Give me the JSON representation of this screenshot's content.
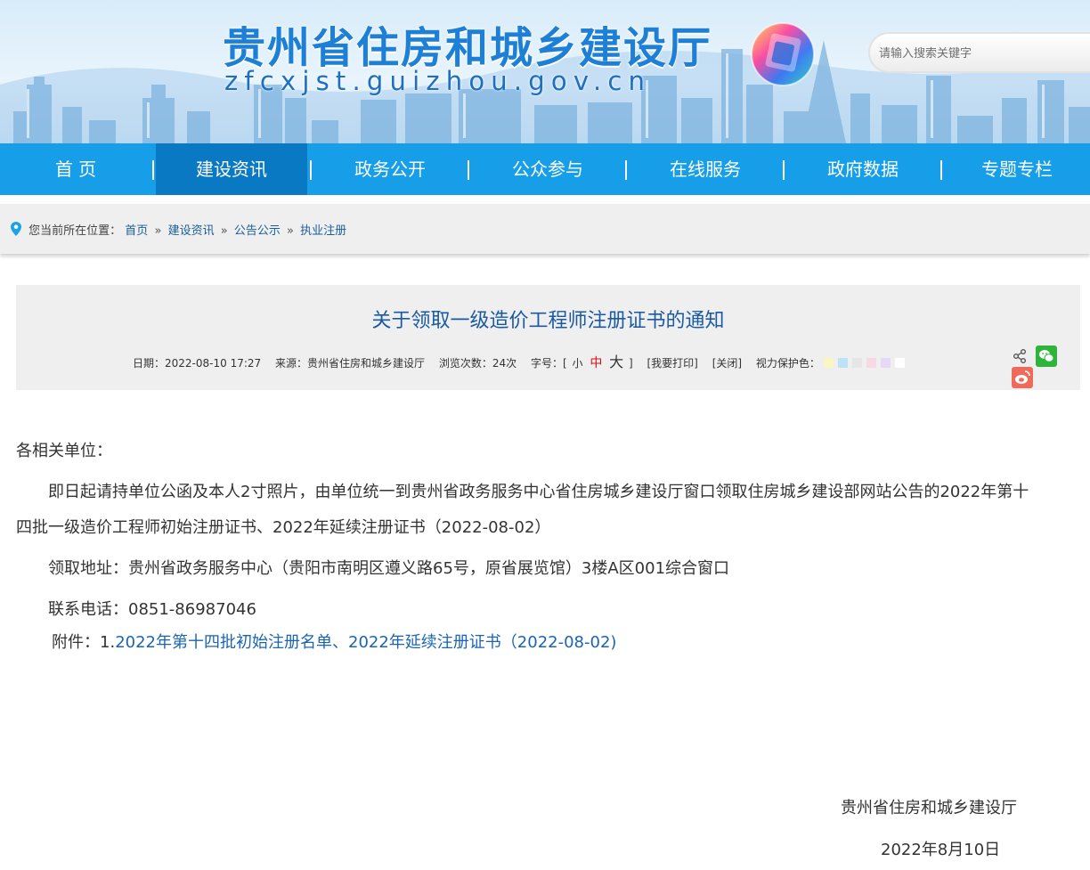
{
  "header": {
    "site_title": "贵州省住房和城乡建设厅",
    "site_domain": "zfcxjst.guizhou.gov.cn",
    "search_placeholder": "请输入搜索关键字"
  },
  "nav": {
    "items": [
      {
        "label": "首 页",
        "active": false
      },
      {
        "label": "建设资讯",
        "active": true
      },
      {
        "label": "政务公开",
        "active": false
      },
      {
        "label": "公众参与",
        "active": false
      },
      {
        "label": "在线服务",
        "active": false
      },
      {
        "label": "政府数据",
        "active": false
      },
      {
        "label": "专题专栏",
        "active": false
      }
    ]
  },
  "breadcrumb": {
    "prefix": "您当前所在位置：",
    "items": [
      "首页",
      "建设资讯",
      "公告公示",
      "执业注册"
    ],
    "separator": "»"
  },
  "article": {
    "title": "关于领取一级造价工程师注册证书的通知",
    "meta": {
      "date_label": "日期：",
      "date": "2022-08-10 17:27",
      "source_label": "来源：",
      "source": "贵州省住房和城乡建设厅",
      "views_label": "浏览次数：",
      "views": "24次",
      "fontsize_label": "字号：",
      "font_small": "小",
      "font_medium": "中",
      "font_large": "大",
      "print": "[我要打印]",
      "close": "[关闭]",
      "eye_care_label": "视力保护色：",
      "eye_care_colors": [
        "#faf6c2",
        "#bde1f5",
        "#e6e6e6",
        "#f7d9e3",
        "#e6d9f7",
        "#ffffff"
      ]
    },
    "greeting": "各相关单位：",
    "para1_line1": "即日起请持单位公函及本人2寸照片，由单位统一到贵州省政务服务中心省住房城乡建设厅窗口领取住房城乡建设部网站公告的2022年第十",
    "para1_line2": "四批一级造价工程师初始注册证书、2022年延续注册证书（2022-08-02）",
    "address": "领取地址：贵州省政务服务中心（贵阳市南明区遵义路65号，原省展览馆）3楼A区001综合窗口",
    "phone": "联系电话：0851-86987046",
    "attachment_label": "附件：1.",
    "attachment_link": "2022年第十四批初始注册名单、2022年延续注册证书（2022-08-02)",
    "signature": "贵州省住房和城乡建设厅",
    "sign_date": "2022年8月10日"
  },
  "colors": {
    "nav_bg": "#169fe8",
    "nav_active": "#0a79c4",
    "title_blue": "#1b5aa3",
    "link_blue": "#1a64b4"
  }
}
